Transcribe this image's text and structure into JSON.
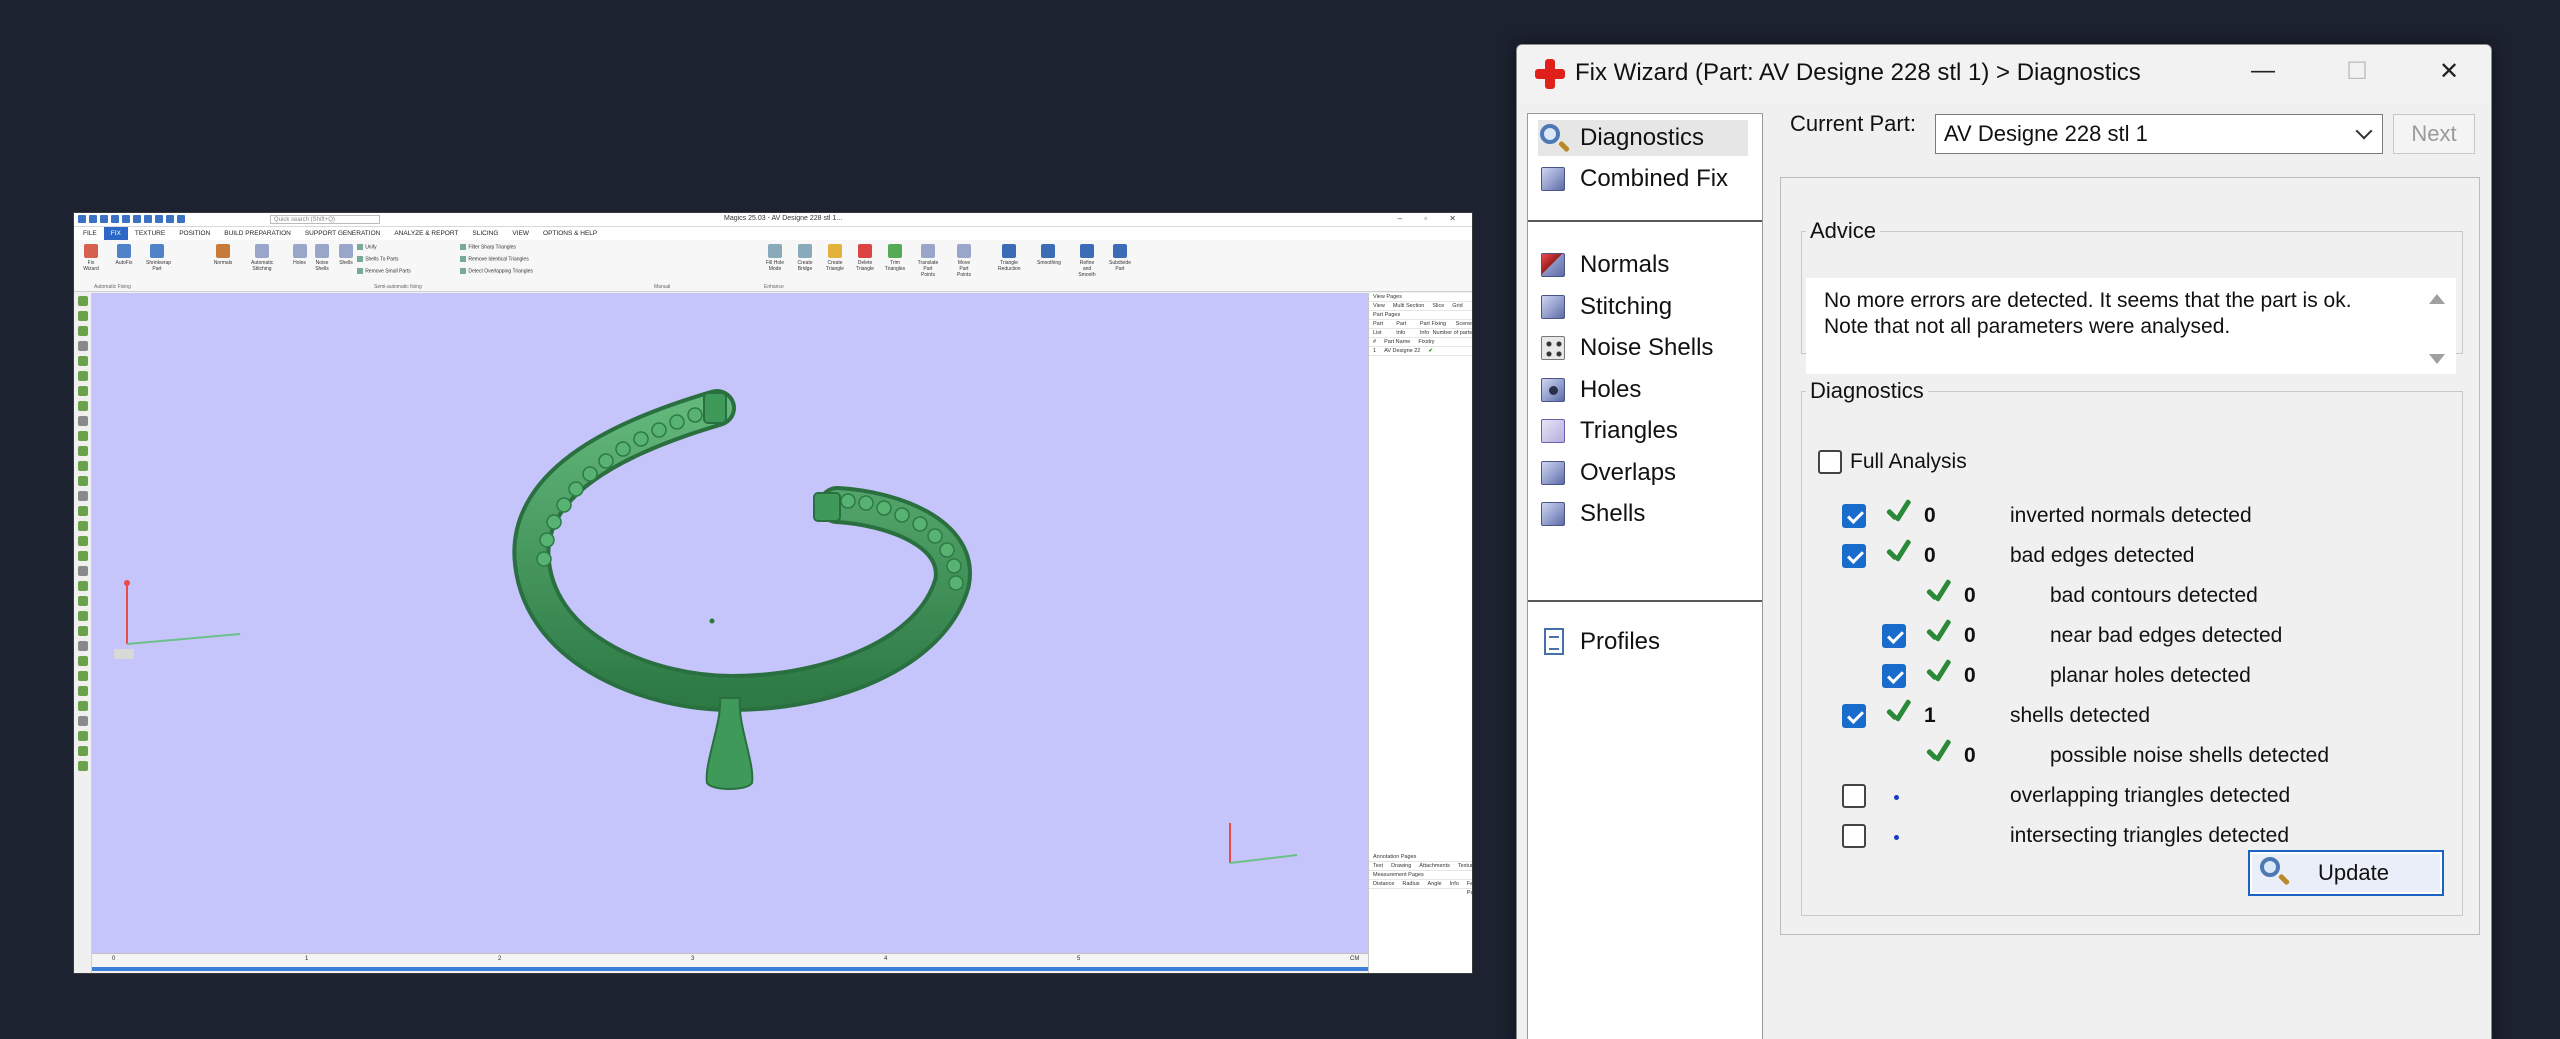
{
  "magics": {
    "title": "Magics 25.03 - AV Designe 228 stl 1...",
    "search_placeholder": "Quick search (Shift+Q)",
    "window_controls": "– ▫ ✕",
    "menu": [
      "FILE",
      "FIX",
      "TEXTURE",
      "POSITION",
      "BUILD PREPARATION",
      "SUPPORT GENERATION",
      "ANALYZE & REPORT",
      "SLICING",
      "VIEW",
      "OPTIONS & HELP"
    ],
    "ribbon": {
      "buttons": [
        "Fix Wizard",
        "AutoFix",
        "Shrinkwrap Part",
        "Normals",
        "Automatic Stitching",
        "Holes",
        "Noise Shells",
        "Shells",
        "Fill Hole Mode",
        "Create Bridge",
        "Create Triangle",
        "Delete Triangle",
        "Trim Triangles",
        "Translate Part Points",
        "Move Part Points",
        "Triangle Reduction",
        "Smoothing",
        "Refine and Smooth",
        "Subdivide Part"
      ],
      "small_items": [
        "Unify",
        "Shells To Parts",
        "Remove Small Parts",
        "Filter Sharp Triangles",
        "Remove Identical Triangles",
        "Detect Overlapping Triangles"
      ],
      "groups": [
        "Automatic Fixing",
        "Semi-automatic fixing",
        "Manual",
        "Enhance"
      ]
    },
    "ruler_ticks": [
      "0",
      "1",
      "2",
      "3",
      "4",
      "5",
      "CM"
    ],
    "right_panel": {
      "view_pages": "View Pages",
      "view_tabs": [
        "View",
        "Multi Section",
        "Slice",
        "Grid"
      ],
      "part_pages": "Part Pages",
      "part_tabs": [
        "Part List",
        "Part Info",
        "Part Fixing Info",
        "Scenes"
      ],
      "number_of_parts": "Number of parts",
      "columns": [
        "#",
        "Part Name",
        "Fixstry"
      ],
      "row_index": "1",
      "row_name": "AV Designe 22",
      "annotation_pages": "Annotation Pages",
      "annotation_tabs": [
        "Text",
        "Drawing",
        "Attachments",
        "Textures"
      ],
      "measurement_pages": "Measurement Pages",
      "measurement_tabs": [
        "Distance",
        "Radius",
        "Angle",
        "Info",
        "Feat Part"
      ]
    },
    "colors": {
      "viewport": "#c6c5fb",
      "part": "#3f9a5a"
    }
  },
  "wizard": {
    "title": "Fix Wizard (Part: AV Designe 228 stl 1) > Diagnostics",
    "window_controls": {
      "minimize": "—",
      "maximize": "☐",
      "close": "✕"
    },
    "nav": {
      "top": [
        {
          "label": "Diagnostics",
          "icon": "magnifier-icon",
          "selected": true
        },
        {
          "label": "Combined Fix",
          "icon": "cube-icon"
        }
      ],
      "middle": [
        {
          "label": "Normals",
          "icon": "normals-cube-icon"
        },
        {
          "label": "Stitching",
          "icon": "stitching-cube-icon"
        },
        {
          "label": "Noise Shells",
          "icon": "noise-shells-icon"
        },
        {
          "label": "Holes",
          "icon": "holes-cube-icon"
        },
        {
          "label": "Triangles",
          "icon": "triangles-icon"
        },
        {
          "label": "Overlaps",
          "icon": "overlaps-cube-icon"
        },
        {
          "label": "Shells",
          "icon": "shells-cube-icon"
        }
      ],
      "bottom": [
        {
          "label": "Profiles",
          "icon": "document-icon"
        }
      ]
    },
    "current_part_label": "Current Part:",
    "current_part_value": "AV Designe 228 stl 1",
    "next_label": "Next",
    "advice": {
      "legend": "Advice",
      "text": "No more errors are detected. It seems that the part is ok. Note that not all parameters were analysed."
    },
    "diagnostics": {
      "legend": "Diagnostics",
      "full_analysis_label": "Full Analysis",
      "full_analysis_checked": false,
      "rows": [
        {
          "label": "inverted normals detected",
          "count": "0",
          "checked": true,
          "indent": false,
          "status": "ok"
        },
        {
          "label": "bad edges detected",
          "count": "0",
          "checked": true,
          "indent": false,
          "status": "ok"
        },
        {
          "label": "bad contours detected",
          "count": "0",
          "checked": null,
          "indent": true,
          "status": "ok"
        },
        {
          "label": "near bad edges detected",
          "count": "0",
          "checked": true,
          "indent": true,
          "status": "ok"
        },
        {
          "label": "planar holes detected",
          "count": "0",
          "checked": true,
          "indent": true,
          "status": "ok"
        },
        {
          "label": "shells detected",
          "count": "1",
          "checked": true,
          "indent": false,
          "status": "ok"
        },
        {
          "label": "possible noise shells detected",
          "count": "0",
          "checked": null,
          "indent": true,
          "status": "ok"
        },
        {
          "label": "overlapping triangles detected",
          "count": "",
          "checked": false,
          "indent": false,
          "status": "pending"
        },
        {
          "label": "intersecting triangles detected",
          "count": "",
          "checked": false,
          "indent": false,
          "status": "pending"
        }
      ]
    },
    "update_label": "Update",
    "colors": {
      "accent": "#1a6ccc",
      "ok": "#2a8a3a",
      "title_icon": "#e0201b"
    }
  }
}
